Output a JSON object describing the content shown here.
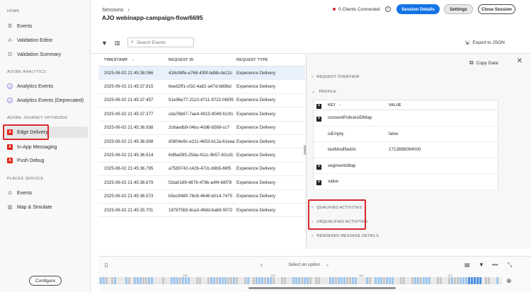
{
  "sidebar": {
    "sections": [
      {
        "label": "HOME"
      },
      {
        "label": "ADOBE ANALYTICS"
      },
      {
        "label": "ADOBE JOURNEY OPTIMIZER"
      },
      {
        "label": "PLACES SERVICE"
      }
    ],
    "items": [
      {
        "label": "Events",
        "icon": "list-icon"
      },
      {
        "label": "Validation Editor",
        "icon": "code-icon"
      },
      {
        "label": "Validation Summary",
        "icon": "checklist-icon"
      },
      {
        "label": "Analytics Events",
        "icon": "analytics-icon"
      },
      {
        "label": "Analytics Events (Deprecated)",
        "icon": "analytics-icon"
      },
      {
        "label": "Edge Delivery",
        "icon": "ajo-icon"
      },
      {
        "label": "In-App Messaging",
        "icon": "ajo-icon"
      },
      {
        "label": "Push Debug",
        "icon": "ajo-icon"
      },
      {
        "label": "Events",
        "icon": "pin-icon"
      },
      {
        "label": "Map & Simulate",
        "icon": "map-icon"
      }
    ],
    "configure_label": "Configure"
  },
  "header": {
    "breadcrumb": "Sessions",
    "breadcrumb_sep": "›",
    "title": "AJO webinapp-campaign-flow/6695",
    "clients_connected": "0 Clients Connected",
    "session_details_label": "Session Details",
    "settings_label": "Settings",
    "close_session_label": "Close Session"
  },
  "toolbar": {
    "search_placeholder": "Search Events",
    "export_label": "Export to JSON"
  },
  "events_table": {
    "columns": [
      "TIMESTAMP",
      "REQUEST ID",
      "REQUEST TYPE"
    ],
    "sort_indicator": "↓",
    "rows": [
      {
        "timestamp": "2025-06-02 21:45:38.066",
        "request_id": "418c98fe-e768-435f-bd8b-de12c",
        "type": "Experience Delivery"
      },
      {
        "timestamp": "2025-06-02 21:45:37.815",
        "request_id": "6ee82ff1-cf32-4a82-a47d-b89bd",
        "type": "Experience Delivery"
      },
      {
        "timestamp": "2025-06-02 21:45:37.457",
        "request_id": "51e96e77-2110-4711-9722-065f9",
        "type": "Experience Delivery"
      },
      {
        "timestamp": "2025-06-02 21:45:37.377",
        "request_id": "cda76b87-7ae4-4915-9049-fcc91",
        "type": "Experience Delivery"
      },
      {
        "timestamp": "2025-06-02 21:45:36.938",
        "request_id": "2c6aedb9-04bc-40d6-b588-cc7",
        "type": "Experience Delivery"
      },
      {
        "timestamp": "2025-06-02 21:45:36.908",
        "request_id": "d0804e9c-e211-4653-b12a-61eea",
        "type": "Experience Delivery"
      },
      {
        "timestamp": "2025-06-02 21:45:36.814",
        "request_id": "6dfba095-25da-411c-9b57-82cd1",
        "type": "Experience Delivery"
      },
      {
        "timestamp": "2025-06-02 21:45:36.795",
        "request_id": "a7580742-c42b-472c-b9b5-66f5",
        "type": "Experience Delivery"
      },
      {
        "timestamp": "2025-06-02 21:45:36.679",
        "request_id": "f2da0189-4876-478b-a4f4-68f78",
        "type": "Experience Delivery"
      },
      {
        "timestamp": "2025-06-02 21:45:36.573",
        "request_id": "b5ec9480-76c8-4646-b014-7475",
        "type": "Experience Delivery"
      },
      {
        "timestamp": "2025-06-02 21:45:35.701",
        "request_id": "187875b5-6ca3-48dd-bab9-5072",
        "type": "Experience Delivery"
      }
    ]
  },
  "detail": {
    "copy_label": "Copy Data",
    "sections": {
      "request_overview": "REQUEST OVERVIEW",
      "profile": "PROFILE",
      "qualified": "QUALIFIED ACTIVITIES",
      "unqualified": "UNQUALIFIED ACTIVITIES",
      "rendered": "RENDERED MESSAGE DETAILS"
    },
    "profile_columns": [
      "KEY",
      "VALUE"
    ],
    "profile_sort": "↑",
    "profile_rows": [
      {
        "key": "consentPoliciesIDMap",
        "value": "",
        "expandable": true
      },
      {
        "key": "isEmpty",
        "value": "false",
        "expandable": false
      },
      {
        "key": "lastModifiedAt",
        "value": "1713888094000",
        "expandable": false
      },
      {
        "key": "segmentsMap",
        "value": "",
        "expandable": true
      },
      {
        "key": "value",
        "value": "",
        "expandable": true
      }
    ]
  },
  "bottom": {
    "select_placeholder": "Select an option",
    "timeline_labels": [
      "100",
      "120",
      "150",
      "175"
    ]
  },
  "colors": {
    "accent": "#1473e6",
    "highlight": "#d7262b",
    "status_disconnected": "#d7262b",
    "timeline_event": "#9fc7ef"
  }
}
